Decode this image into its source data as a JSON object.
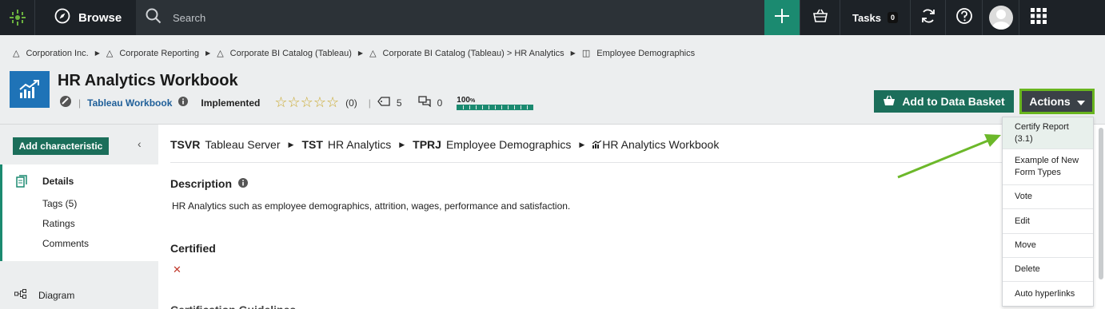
{
  "topbar": {
    "browse_label": "Browse",
    "search_placeholder": "Search",
    "tasks_label": "Tasks",
    "tasks_count": "0",
    "icons": [
      "app-logo-icon",
      "compass-icon",
      "search-icon",
      "plus-icon",
      "basket-icon",
      "sync-icon",
      "help-icon",
      "avatar-icon",
      "apps-grid-icon"
    ]
  },
  "breadcrumb": [
    "Corporation Inc.",
    "Corporate Reporting",
    "Corporate BI Catalog (Tableau)",
    "Corporate BI Catalog (Tableau) > HR Analytics",
    "Employee Demographics"
  ],
  "asset": {
    "title": "HR Analytics Workbook",
    "type": "Tableau Workbook",
    "status": "Implemented",
    "rating_count": "(0)",
    "tags_count": "5",
    "comments_count": "0",
    "completeness": "100",
    "completeness_unit": "%",
    "completeness_fraction": 1.0
  },
  "buttons": {
    "add_to_basket": "Add to Data Basket",
    "actions": "Actions",
    "add_characteristic": "Add characteristic"
  },
  "sidebar": {
    "items": [
      "Details",
      "Tags (5)",
      "Ratings",
      "Comments"
    ],
    "diagram": "Diagram"
  },
  "main": {
    "path": [
      {
        "code": "TSVR",
        "name": "Tableau Server"
      },
      {
        "code": "TST",
        "name": "HR Analytics"
      },
      {
        "code": "TPRJ",
        "name": "Employee Demographics"
      },
      {
        "code": "",
        "name": "HR Analytics Workbook"
      }
    ],
    "description_heading": "Description",
    "description_text": "HR Analytics such as employee demographics, attrition, wages, performance and satisfaction.",
    "certified_heading": "Certified",
    "next_heading_partial": "Certification Guidelines"
  },
  "actions_menu": [
    "Certify Report (3.1)",
    "Example of New Form Types",
    "Vote",
    "Edit",
    "Move",
    "Delete",
    "Auto hyperlinks"
  ],
  "colors": {
    "topbar": "#1d2227",
    "accent_green": "#1b8a70",
    "highlight_green": "#69b51f",
    "asset_blue": "#1f73b7"
  }
}
